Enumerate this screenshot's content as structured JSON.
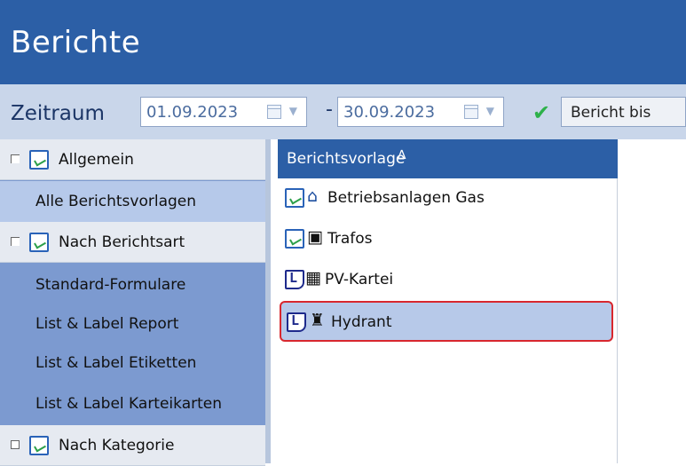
{
  "window": {
    "title": "Berichte"
  },
  "toolbar": {
    "zeitraum_label": "Zeitraum",
    "date_from": "01.09.2023",
    "separator": "-",
    "date_to": "30.09.2023",
    "apply_icon": "checkmark-icon",
    "bericht_bis_label": "Bericht bis"
  },
  "sidebar": {
    "groups": [
      {
        "label": "Allgemein",
        "icon": "report-icon"
      },
      {
        "label": "Nach Berichtsart",
        "icon": "report-icon"
      },
      {
        "label": "Nach Kategorie",
        "icon": "report-icon"
      }
    ],
    "items": {
      "alle": "Alle Berichtsvorlagen",
      "standard": "Standard-Formulare",
      "report": "List & Label Report",
      "etiketten": "List & Label Etiketten",
      "karteikarten": "List & Label Karteikarten"
    }
  },
  "grid": {
    "column_header": "Berichtsvorlage",
    "sort_indicator": "∆",
    "rows": [
      {
        "label": "Betriebsanlagen Gas",
        "type_icon": "report-icon",
        "category_icon": "house-icon"
      },
      {
        "label": "Trafos",
        "type_icon": "report-icon",
        "category_icon": "transformer-icon"
      },
      {
        "label": "PV-Kartei",
        "type_icon": "list-label-icon",
        "category_icon": "solar-panel-icon"
      },
      {
        "label": "Hydrant",
        "type_icon": "list-label-icon",
        "category_icon": "hydrant-icon",
        "selected": true
      }
    ]
  },
  "colors": {
    "titlebar": "#2c5fa6",
    "toolbar": "#c9d6ea",
    "sidebar": "#7c9ad0",
    "selection_border": "#d8272e",
    "check": "#2db14a"
  }
}
